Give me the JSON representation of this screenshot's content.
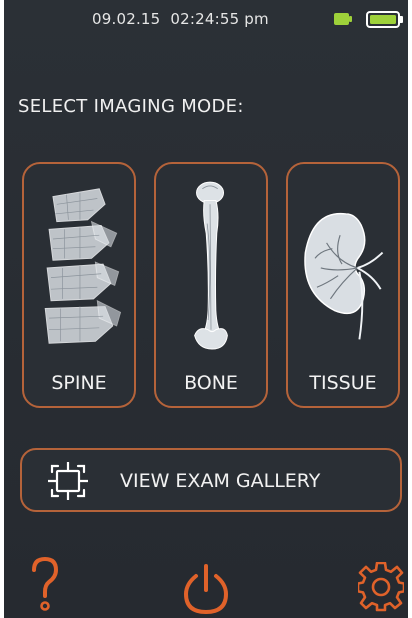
{
  "status_bar": {
    "date": "09.02.15",
    "time": "02:24:55 pm",
    "battery_color": "#9ed13a"
  },
  "heading": "SELECT IMAGING MODE:",
  "modes": [
    {
      "label": "SPINE",
      "icon": "spine-xray-icon"
    },
    {
      "label": "BONE",
      "icon": "bone-xray-icon"
    },
    {
      "label": "TISSUE",
      "icon": "kidney-tissue-icon"
    }
  ],
  "gallery_button": {
    "label": "VIEW EXAM GALLERY",
    "icon": "gallery-frame-icon"
  },
  "footer": {
    "help_icon": "help-icon",
    "power_icon": "power-icon",
    "settings_icon": "gear-icon"
  },
  "colors": {
    "accent": "#b5633a",
    "icon_orange": "#e0622a",
    "background": "#2b3036",
    "text": "#f2f2f2"
  }
}
